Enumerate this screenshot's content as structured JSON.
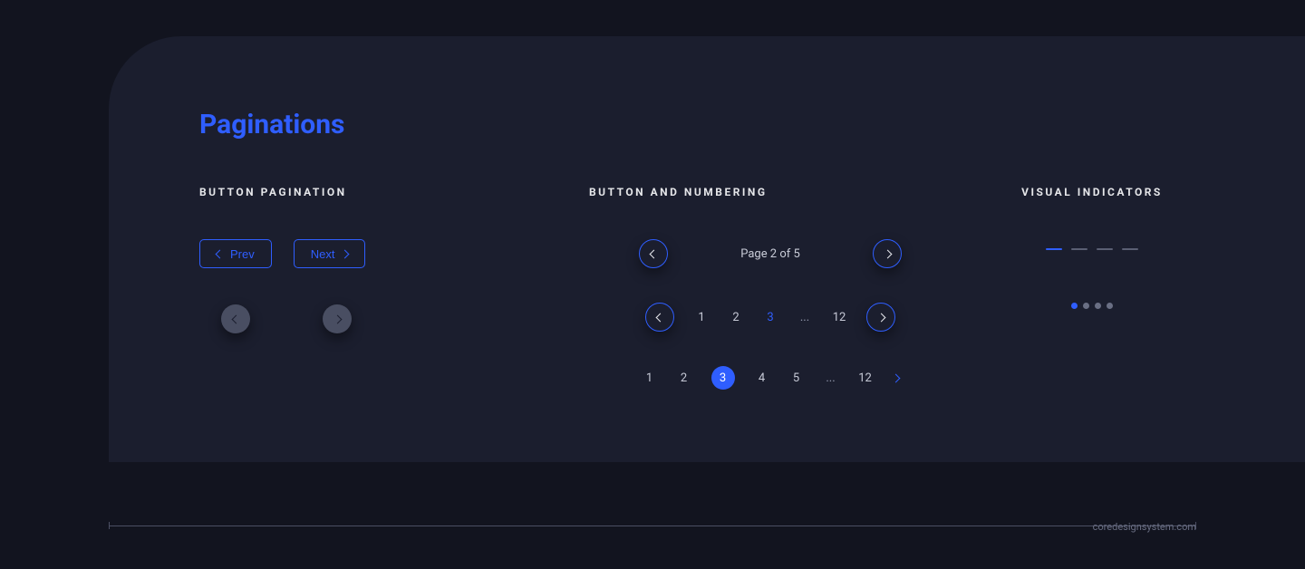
{
  "title": "Paginations",
  "sections": {
    "button_pagination": "BUTTON PAGINATION",
    "button_numbering": "BUTTON AND NUMBERING",
    "visual_indicators": "VISUAL INDICATORS"
  },
  "button_pagination": {
    "prev_label": "Prev",
    "next_label": "Next"
  },
  "numbering": {
    "page_status": "Page 2 of 5",
    "row2": {
      "items": [
        "1",
        "2",
        "3",
        "...",
        "12"
      ],
      "active_index": 2
    },
    "row3": {
      "items": [
        "1",
        "2",
        "3",
        "4",
        "5",
        "...",
        "12"
      ],
      "active_index": 2
    }
  },
  "visual_indicators": {
    "dash_count": 4,
    "dash_active_index": 0,
    "dot_count": 4,
    "dot_active_index": 0
  },
  "footer": "coredesignsystem.com"
}
